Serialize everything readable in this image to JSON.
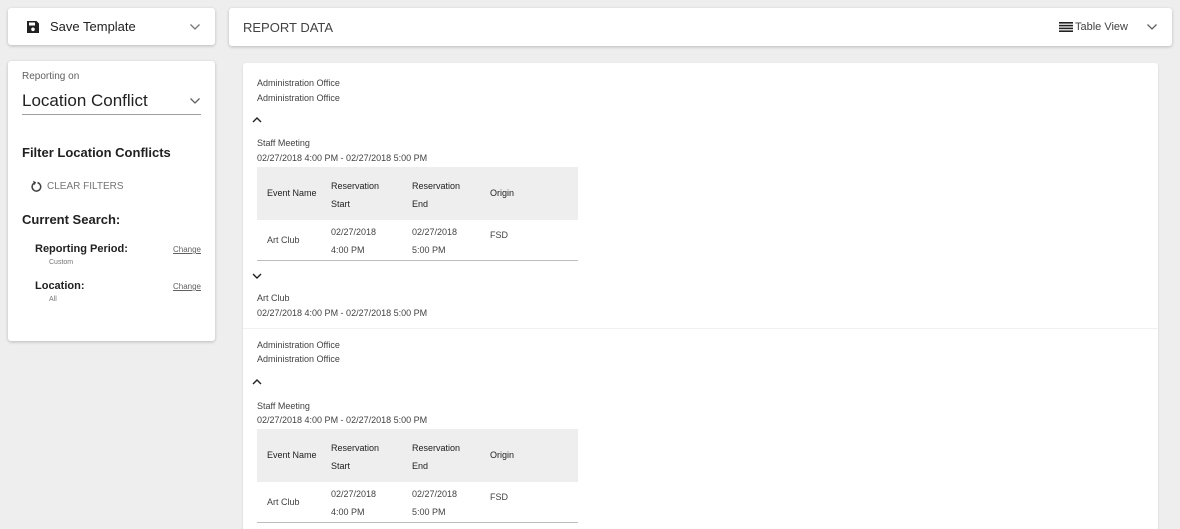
{
  "toolbar": {
    "save_label": "Save Template"
  },
  "report_header": {
    "title": "REPORT DATA",
    "view_label": "Table View"
  },
  "sidebar": {
    "reporting_on_label": "Reporting on",
    "report_type": "Location Conflict",
    "filter_title": "Filter Location Conflicts",
    "clear_filters": "CLEAR FILTERS",
    "current_search": "Current Search:",
    "criteria": [
      {
        "label": "Reporting Period:",
        "change": "Change",
        "value": "Custom"
      },
      {
        "label": "Location:",
        "change": "Change",
        "value": "All"
      }
    ]
  },
  "table_headers": {
    "event_name": "Event Name",
    "res_start_1": "Reservation",
    "res_start_2": "Start",
    "res_end_1": "Reservation",
    "res_end_2": "End",
    "origin": "Origin"
  },
  "groups": [
    {
      "location_1": "Administration Office",
      "location_2": "Administration Office",
      "event_title": "Staff Meeting",
      "event_range": "02/27/2018 4:00 PM - 02/27/2018 5:00 PM",
      "row": {
        "name": "Art Club",
        "start_date": "02/27/2018",
        "start_time": "4:00 PM",
        "end_date": "02/27/2018",
        "end_time": "5:00 PM",
        "origin": "FSD"
      },
      "conflict_title": "Art Club",
      "conflict_range": "02/27/2018 4:00 PM - 02/27/2018 5:00 PM"
    },
    {
      "location_1": "Administration Office",
      "location_2": "Administration Office",
      "event_title": "Staff Meeting",
      "event_range": "02/27/2018 4:00 PM - 02/27/2018 5:00 PM",
      "row": {
        "name": "Art Club",
        "start_date": "02/27/2018",
        "start_time": "4:00 PM",
        "end_date": "02/27/2018",
        "end_time": "5:00 PM",
        "origin": "FSD"
      }
    }
  ]
}
